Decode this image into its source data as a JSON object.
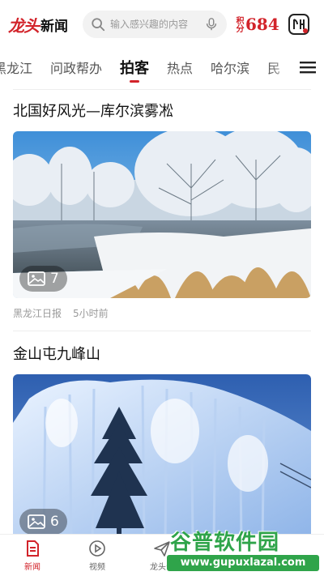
{
  "header": {
    "logo_mark": "龙头",
    "logo_text": "新闻",
    "search_placeholder": "输入感兴趣的内容",
    "points_label": "积分",
    "points_value": "684"
  },
  "tabs": [
    {
      "label": "黑龙江",
      "active": false
    },
    {
      "label": "问政帮办",
      "active": false
    },
    {
      "label": "拍客",
      "active": true
    },
    {
      "label": "热点",
      "active": false
    },
    {
      "label": "哈尔滨",
      "active": false
    },
    {
      "label": "民",
      "active": false
    }
  ],
  "articles": [
    {
      "title": "北国好风光—库尔滨雾凇",
      "image_count": "7",
      "source": "黑龙江日报",
      "time": "5小时前"
    },
    {
      "title": "金山屯九峰山",
      "image_count": "6"
    }
  ],
  "bottom_nav": [
    {
      "label": "新闻",
      "icon": "news-icon",
      "active": true
    },
    {
      "label": "视频",
      "icon": "video-icon",
      "active": false
    },
    {
      "label": "龙头号",
      "icon": "send-icon",
      "active": false
    }
  ],
  "watermark": {
    "title": "谷普软件园",
    "url": "www.gupuxlazal.com"
  },
  "colors": {
    "brand_red": "#d2232a",
    "watermark_green": "#2fa44a"
  }
}
